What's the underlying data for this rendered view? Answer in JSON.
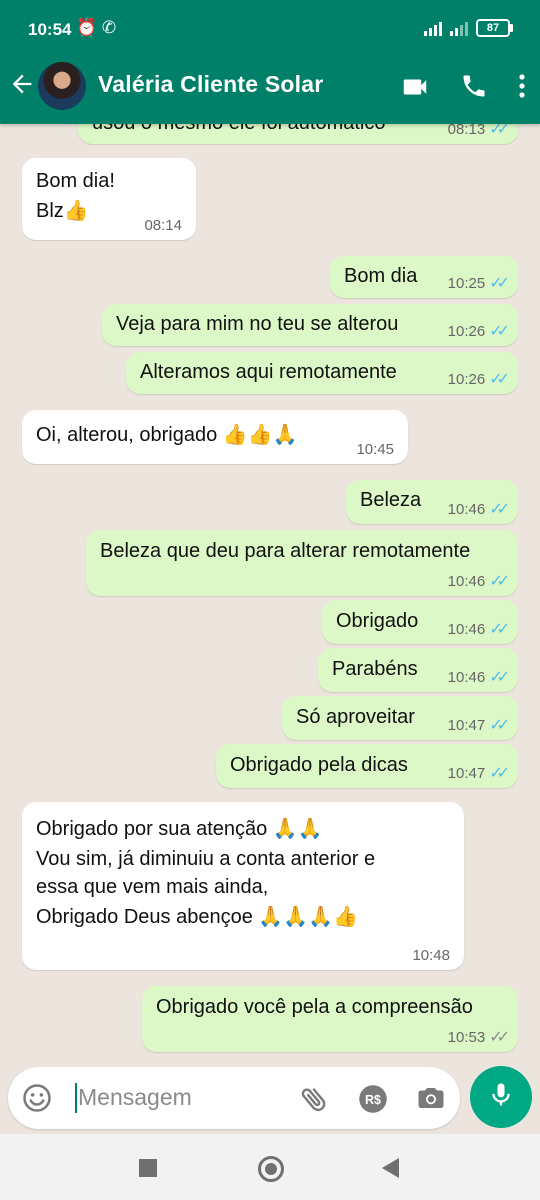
{
  "status_bar": {
    "time": "10:54",
    "icons": "⏰ ✆",
    "battery": "87"
  },
  "contact": {
    "name": "Valéria Cliente Solar"
  },
  "messages": [
    {
      "dir": "out",
      "text": "usou o mesmo ele foi automatico",
      "time": "08:13",
      "ticks": "✓✓"
    },
    {
      "dir": "in",
      "line1": "Bom dia!",
      "line2": "Blz👍",
      "time": "08:14"
    },
    {
      "dir": "out",
      "text": "Bom dia",
      "time": "10:25",
      "ticks": "✓✓"
    },
    {
      "dir": "out",
      "text": "Veja para mim no teu se alterou",
      "time": "10:26",
      "ticks": "✓✓"
    },
    {
      "dir": "out",
      "text": "Alteramos aqui remotamente",
      "time": "10:26",
      "ticks": "✓✓"
    },
    {
      "dir": "in",
      "text": "Oi, alterou, obrigado 👍👍🙏",
      "time": "10:45"
    },
    {
      "dir": "out",
      "text": "Beleza",
      "time": "10:46",
      "ticks": "✓✓"
    },
    {
      "dir": "out",
      "text": "Beleza que deu para alterar remotamente",
      "time": "10:46",
      "ticks": "✓✓"
    },
    {
      "dir": "out",
      "text": "Obrigado",
      "time": "10:46",
      "ticks": "✓✓"
    },
    {
      "dir": "out",
      "text": "Parabéns",
      "time": "10:46",
      "ticks": "✓✓"
    },
    {
      "dir": "out",
      "text": "Só aproveitar",
      "time": "10:47",
      "ticks": "✓✓"
    },
    {
      "dir": "out",
      "text": "Obrigado pela dicas",
      "time": "10:47",
      "ticks": "✓✓"
    },
    {
      "dir": "in",
      "line1": "Obrigado por sua atenção 🙏🙏",
      "line2": "Vou sim, já diminuiu a conta anterior e",
      "line3": "essa que vem mais ainda,",
      "line4": "Obrigado Deus abençoe 🙏🙏🙏👍",
      "time": "10:48"
    },
    {
      "dir": "out",
      "text": "Obrigado você pela a compreensão",
      "time": "10:53",
      "ticks": "✓✓",
      "read": false
    }
  ],
  "composer": {
    "placeholder": "Mensagem"
  },
  "colors": {
    "header": "#008069",
    "outgoing": "#dcf8c6",
    "incoming": "#ffffff",
    "read_ticks": "#53bdeb"
  }
}
